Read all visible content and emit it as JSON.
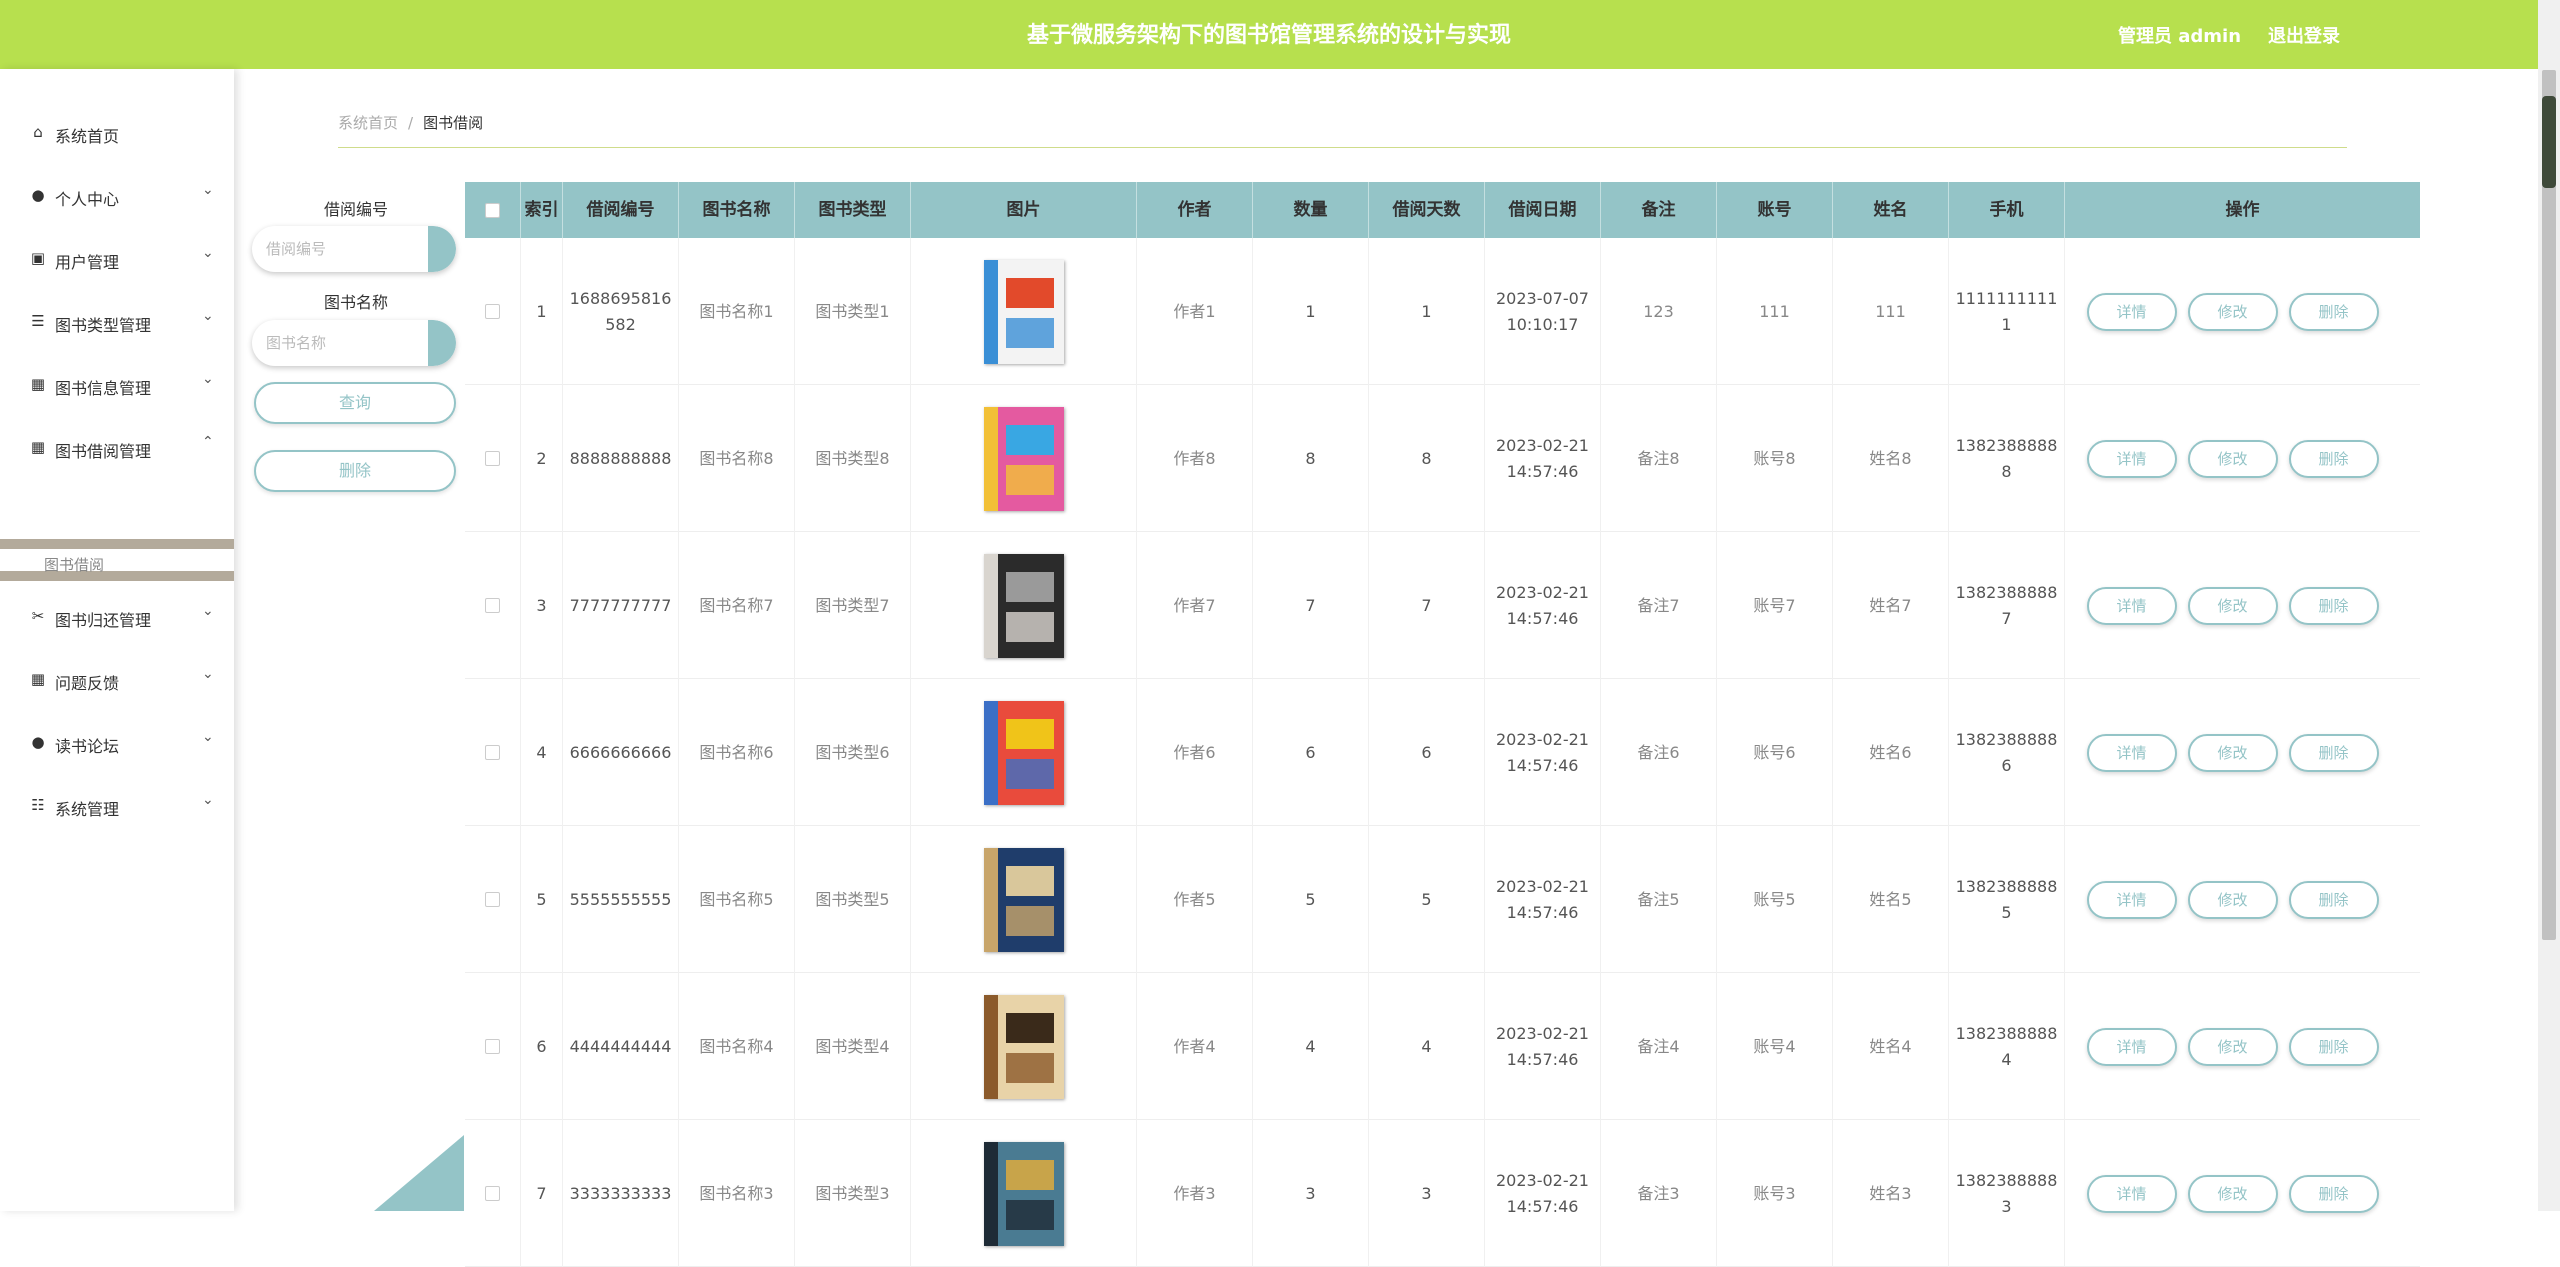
{
  "header": {
    "title": "基于微服务架构下的图书馆管理系统的设计与实现",
    "user": "管理员 admin",
    "logout": "退出登录"
  },
  "sidebar": {
    "items": [
      {
        "label": "系统首页",
        "icon": "home-icon"
      },
      {
        "label": "个人中心",
        "icon": "user-icon"
      },
      {
        "label": "用户管理",
        "icon": "clipboard-icon"
      },
      {
        "label": "图书类型管理",
        "icon": "list-icon"
      },
      {
        "label": "图书信息管理",
        "icon": "grid-icon"
      },
      {
        "label": "图书借阅管理",
        "icon": "grid-icon"
      },
      {
        "label": "图书归还管理",
        "icon": "ticket-icon"
      },
      {
        "label": "问题反馈",
        "icon": "grid-icon"
      },
      {
        "label": "读书论坛",
        "icon": "user-icon"
      },
      {
        "label": "系统管理",
        "icon": "sliders-icon"
      }
    ],
    "submenu": "图书借阅"
  },
  "breadcrumb": {
    "home": "系统首页",
    "sep": "/",
    "current": "图书借阅"
  },
  "search": {
    "field1_label": "借阅编号",
    "field1_placeholder": "借阅编号",
    "field2_label": "图书名称",
    "field2_placeholder": "图书名称",
    "query_button": "查询",
    "delete_button": "删除"
  },
  "table": {
    "headers": [
      "",
      "索引",
      "借阅编号",
      "图书名称",
      "图书类型",
      "图片",
      "作者",
      "数量",
      "借阅天数",
      "借阅日期",
      "备注",
      "账号",
      "姓名",
      "手机",
      "操作"
    ],
    "actions": {
      "detail": "详情",
      "edit": "修改",
      "delete": "删除"
    },
    "rows": [
      {
        "index": "1",
        "code": "1688695816582",
        "name": "图书名称1",
        "type": "图书类型1",
        "cover": "book-cover-1",
        "author": "作者1",
        "qty": "1",
        "days": "1",
        "date": "2023-07-07 10:10:17",
        "note": "123",
        "account": "111",
        "person": "111",
        "phone": "11111111111"
      },
      {
        "index": "2",
        "code": "8888888888",
        "name": "图书名称8",
        "type": "图书类型8",
        "cover": "book-cover-8",
        "author": "作者8",
        "qty": "8",
        "days": "8",
        "date": "2023-02-21 14:57:46",
        "note": "备注8",
        "account": "账号8",
        "person": "姓名8",
        "phone": "13823888888"
      },
      {
        "index": "3",
        "code": "7777777777",
        "name": "图书名称7",
        "type": "图书类型7",
        "cover": "book-cover-7",
        "author": "作者7",
        "qty": "7",
        "days": "7",
        "date": "2023-02-21 14:57:46",
        "note": "备注7",
        "account": "账号7",
        "person": "姓名7",
        "phone": "13823888887"
      },
      {
        "index": "4",
        "code": "6666666666",
        "name": "图书名称6",
        "type": "图书类型6",
        "cover": "book-cover-6",
        "author": "作者6",
        "qty": "6",
        "days": "6",
        "date": "2023-02-21 14:57:46",
        "note": "备注6",
        "account": "账号6",
        "person": "姓名6",
        "phone": "13823888886"
      },
      {
        "index": "5",
        "code": "5555555555",
        "name": "图书名称5",
        "type": "图书类型5",
        "cover": "book-cover-5",
        "author": "作者5",
        "qty": "5",
        "days": "5",
        "date": "2023-02-21 14:57:46",
        "note": "备注5",
        "account": "账号5",
        "person": "姓名5",
        "phone": "13823888885"
      },
      {
        "index": "6",
        "code": "4444444444",
        "name": "图书名称4",
        "type": "图书类型4",
        "cover": "book-cover-4",
        "author": "作者4",
        "qty": "4",
        "days": "4",
        "date": "2023-02-21 14:57:46",
        "note": "备注4",
        "account": "账号4",
        "person": "姓名4",
        "phone": "13823888884"
      },
      {
        "index": "7",
        "code": "3333333333",
        "name": "图书名称3",
        "type": "图书类型3",
        "cover": "book-cover-3",
        "author": "作者3",
        "qty": "3",
        "days": "3",
        "date": "2023-02-21 14:57:46",
        "note": "备注3",
        "account": "账号3",
        "person": "姓名3",
        "phone": "13823888883"
      }
    ]
  },
  "colors": {
    "header": "#b7e04e",
    "accent": "#94c4c7",
    "submenu_band": "#b3aa9b"
  }
}
